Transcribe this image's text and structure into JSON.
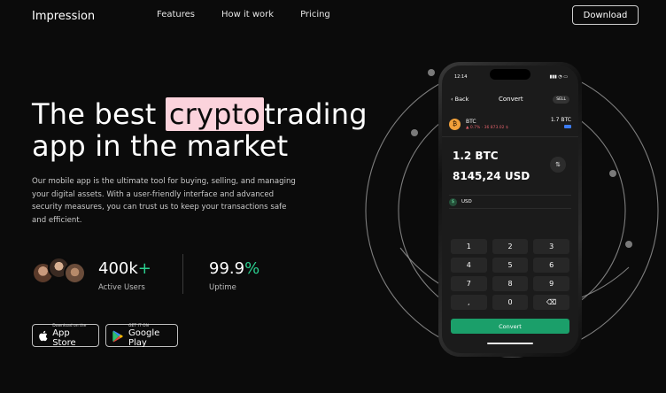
{
  "header": {
    "logo": "Impression",
    "nav": [
      "Features",
      "How it work",
      "Pricing"
    ],
    "download_label": "Download"
  },
  "hero": {
    "headline_before": "The best",
    "headline_highlight": "crypto",
    "headline_after": "trading",
    "headline_line2": "app in the market",
    "highlight_color": "#fbd3dc",
    "description": "Our mobile app is the ultimate tool for buying, selling, and managing your digital assets. With a user-friendly interface and advanced security measures, you can trust us to keep your transactions safe and efficient."
  },
  "stats": {
    "users_value": "400k",
    "users_plus": "+",
    "users_label": "Active Users",
    "uptime_value": "99.9",
    "uptime_pct": "%",
    "uptime_label": "Uptime",
    "accent_color": "#2bcf8f"
  },
  "stores": {
    "apple_small": "Download on the",
    "apple_big": "App Store",
    "google_small": "GET IT ON",
    "google_big": "Google Play"
  },
  "phone": {
    "time": "12:14",
    "status_icons": "▮▮▮ ◔ ▭",
    "back_label": "Back",
    "title": "Convert",
    "sell_label": "SELL",
    "coin_symbol": "₿",
    "coin_name": "BTC",
    "coin_change": "▲ 0.7% · 36 873.02 $",
    "coin_amount": "1.7 BTC",
    "amount_crypto": "1.2 BTC",
    "amount_fiat": "8145,24 USD",
    "swap_icon": "⇅",
    "currency_code": "USD",
    "currency_symbol": "$",
    "keys": [
      "1",
      "2",
      "3",
      "4",
      "5",
      "6",
      "7",
      "8",
      "9",
      ",",
      "0",
      "⌫"
    ],
    "convert_label": "Convert",
    "convert_color": "#1b9f6a"
  }
}
